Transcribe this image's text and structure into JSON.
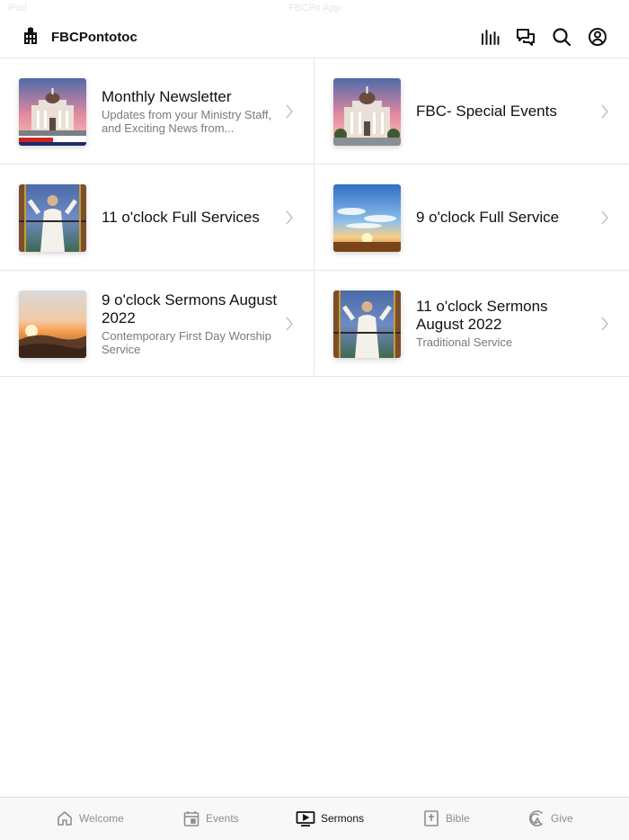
{
  "status_bar": {
    "left": "iPad",
    "center": "FBCPo App"
  },
  "header": {
    "title": "FBCPontotoc",
    "icons": [
      "bars-chart-icon",
      "chat-bubbles-icon",
      "search-icon",
      "account-icon"
    ]
  },
  "items": [
    {
      "title": "Monthly Newsletter",
      "subtitle": "Updates from your Ministry Staff, and Exciting News from...",
      "thumb": "church-building"
    },
    {
      "title": "FBC- Special Events",
      "subtitle": "",
      "thumb": "church-building"
    },
    {
      "title": "11 o'clock Full Services",
      "subtitle": "",
      "thumb": "stained-glass-jesus"
    },
    {
      "title": "9 o'clock Full Service",
      "subtitle": "",
      "thumb": "sunrise-clouds"
    },
    {
      "title": "9 o'clock Sermons August 2022",
      "subtitle": "Contemporary First Day Worship Service",
      "thumb": "sunrise-mountains"
    },
    {
      "title": "11 o'clock Sermons August 2022",
      "subtitle": "Traditional Service",
      "thumb": "stained-glass-jesus"
    }
  ],
  "tabs": [
    {
      "label": "Welcome",
      "icon": "home-icon",
      "active": false
    },
    {
      "label": "Events",
      "icon": "calendar-icon",
      "active": false
    },
    {
      "label": "Sermons",
      "icon": "tv-play-icon",
      "active": true
    },
    {
      "label": "Bible",
      "icon": "bible-icon",
      "active": false
    },
    {
      "label": "Give",
      "icon": "give-icon",
      "active": false
    }
  ],
  "colors": {
    "divider": "#e6e6e6",
    "subtitle": "#7a7a7a",
    "tab_inactive": "#8e8e8e",
    "tab_active": "#111111"
  }
}
